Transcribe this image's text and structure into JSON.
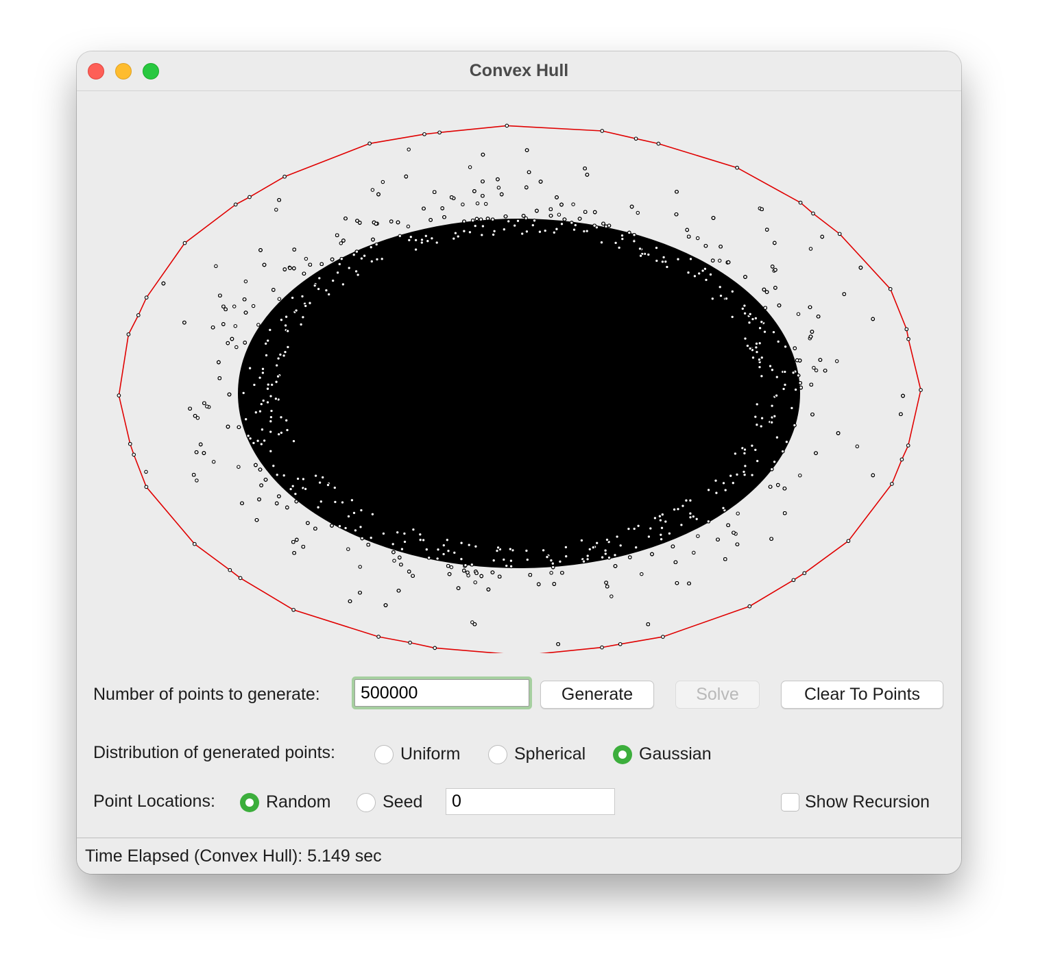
{
  "window": {
    "title": "Convex Hull"
  },
  "controls": {
    "num_points_label": "Number of points to generate:",
    "num_points_value": "500000",
    "generate_label": "Generate",
    "solve_label": "Solve",
    "clear_label": "Clear To Points",
    "distribution_label": "Distribution of generated points:",
    "distribution_options": [
      "Uniform",
      "Spherical",
      "Gaussian"
    ],
    "distribution_selected": "Gaussian",
    "locations_label": "Point Locations:",
    "random_label": "Random",
    "seed_label": "Seed",
    "location_selected": "Random",
    "seed_value": "0",
    "show_recursion_label": "Show Recursion",
    "show_recursion_checked": false
  },
  "status": {
    "text": "Time Elapsed (Convex Hull): 5.149 sec"
  },
  "plot": {
    "point_color": "#000000",
    "hull_color": "#e00000",
    "distribution": "gaussian"
  }
}
